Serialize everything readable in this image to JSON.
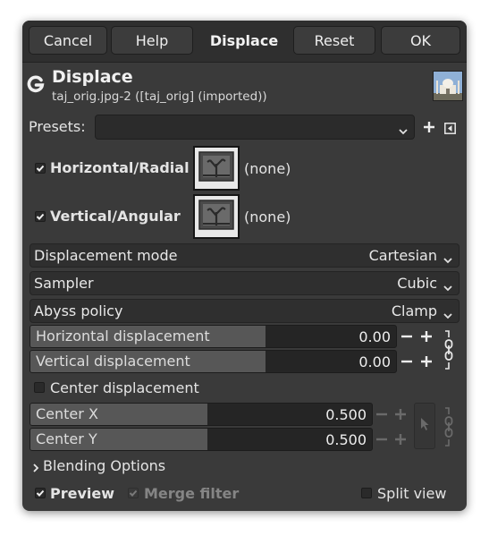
{
  "header": {
    "cancel": "Cancel",
    "help": "Help",
    "title": "Displace",
    "reset": "Reset",
    "ok": "OK"
  },
  "filter": {
    "title": "Displace",
    "subtitle": "taj_orig.jpg-2 ([taj_orig] (imported))"
  },
  "presets": {
    "label": "Presets:",
    "value": ""
  },
  "maps": {
    "horizontal": {
      "label": "Horizontal/Radial",
      "checked": true,
      "value": "(none)"
    },
    "vertical": {
      "label": "Vertical/Angular",
      "checked": true,
      "value": "(none)"
    }
  },
  "combos": {
    "displacement_mode": {
      "label": "Displacement mode",
      "value": "Cartesian"
    },
    "sampler": {
      "label": "Sampler",
      "value": "Cubic"
    },
    "abyss_policy": {
      "label": "Abyss policy",
      "value": "Clamp"
    }
  },
  "displacement": {
    "horizontal": {
      "label": "Horizontal displacement",
      "value": "0.00"
    },
    "vertical": {
      "label": "Vertical displacement",
      "value": "0.00"
    }
  },
  "center": {
    "checkbox_label": "Center displacement",
    "checked": false,
    "x": {
      "label": "Center X",
      "value": "0.500"
    },
    "y": {
      "label": "Center Y",
      "value": "0.500"
    }
  },
  "blending": {
    "label": "Blending Options"
  },
  "footer": {
    "preview": "Preview",
    "merge_filter": "Merge filter",
    "split_view": "Split view"
  },
  "colors": {
    "dialog_bg": "#3a3a3a",
    "header_bg": "#2f2f2f",
    "slider_fill": "#575757",
    "text": "#e8e8e8",
    "disabled_text": "#8a8a8a"
  }
}
